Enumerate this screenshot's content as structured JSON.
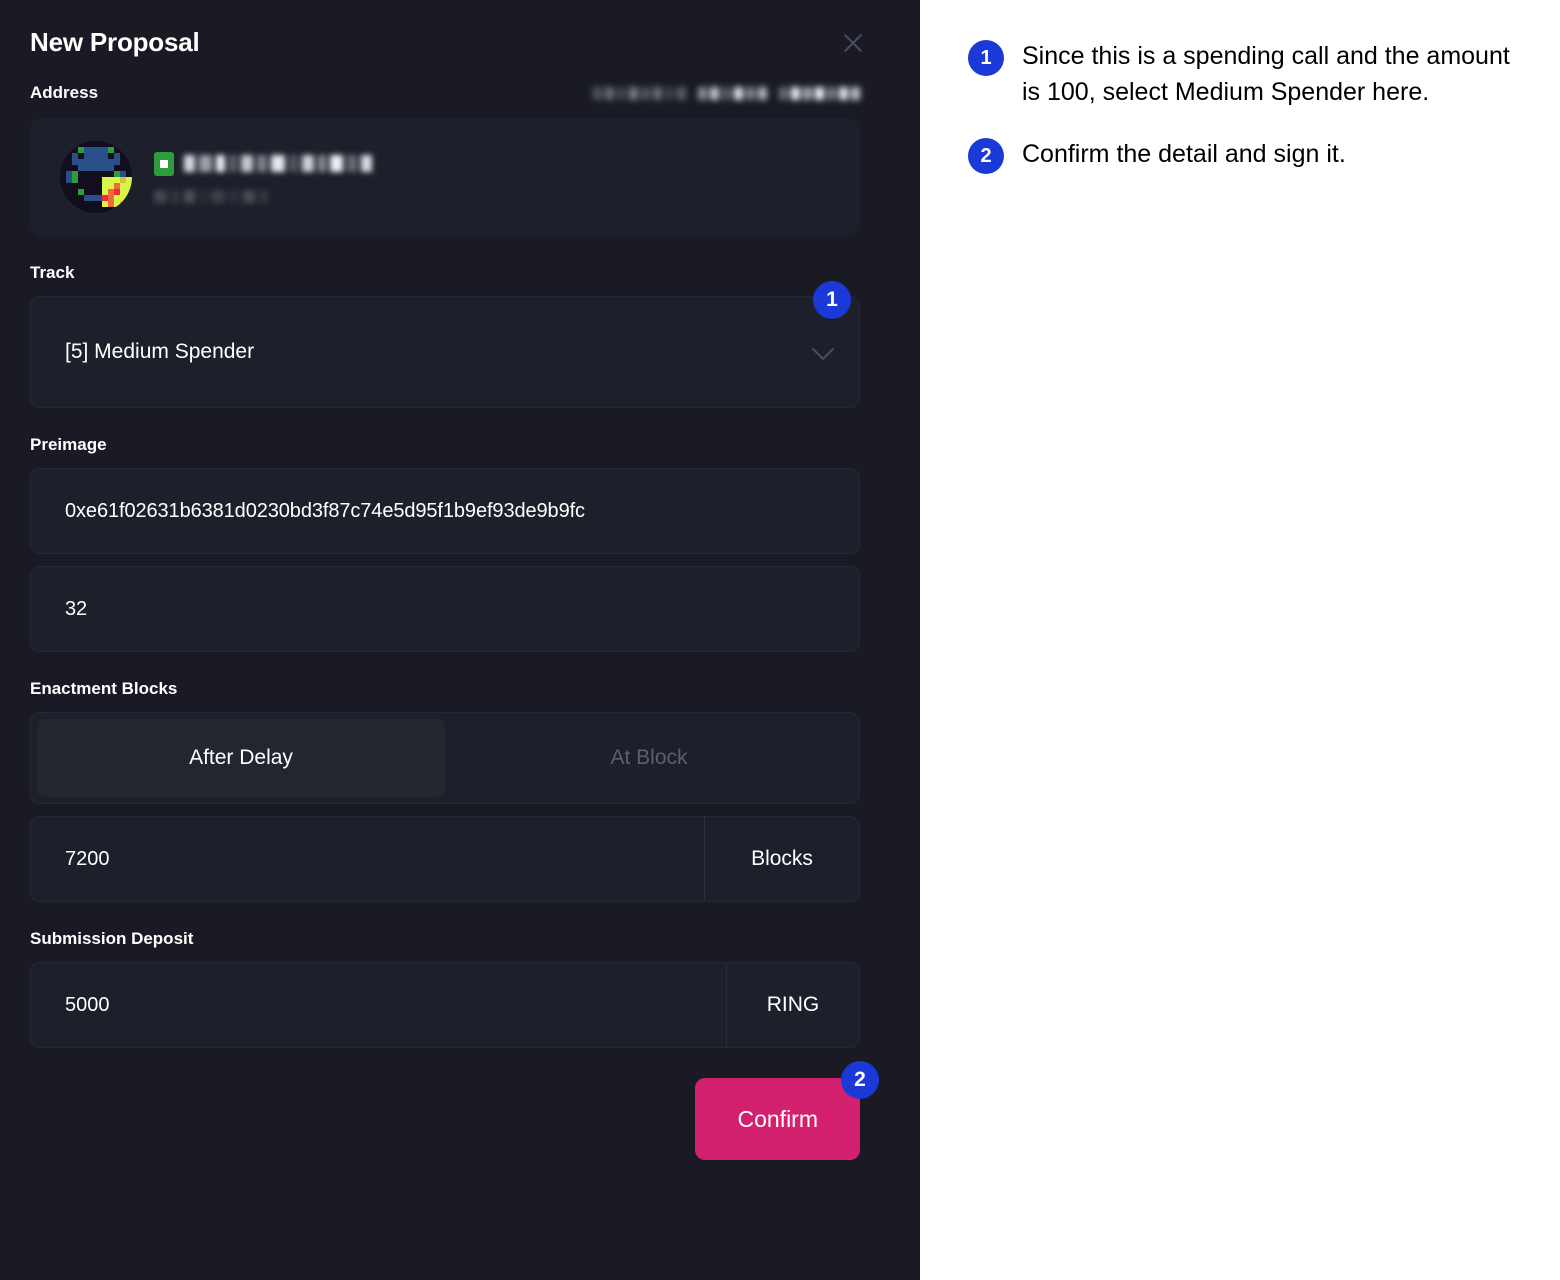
{
  "modal": {
    "title": "New Proposal",
    "close_icon": "close-icon",
    "address": {
      "label": "Address",
      "redacted_value": "[redacted]",
      "account_name_redacted": "[redacted]",
      "account_sub_redacted": "[redacted]",
      "identicon": "identicon-avatar",
      "chain_chip": "chain-chip-icon"
    },
    "track": {
      "label": "Track",
      "value": "[5] Medium Spender",
      "chevron_icon": "chevron-down-icon"
    },
    "preimage": {
      "label": "Preimage",
      "hash": "0xe61f02631b6381d0230bd3f87c74e5d95f1b9ef93de9b9fc",
      "length": "32"
    },
    "enactment": {
      "label": "Enactment Blocks",
      "option_after_delay": "After Delay",
      "option_at_block": "At Block",
      "selected": "After Delay",
      "value": "7200",
      "unit": "Blocks"
    },
    "deposit": {
      "label": "Submission Deposit",
      "value": "5000",
      "unit": "RING"
    },
    "confirm_label": "Confirm",
    "badges": {
      "one": "1",
      "two": "2"
    }
  },
  "notes": [
    {
      "num": "1",
      "text": "Since this is a spending call and the amount is 100, select Medium Spender here."
    },
    {
      "num": "2",
      "text": "Confirm the detail and sign it."
    }
  ],
  "colors": {
    "panel_bg": "#191a24",
    "field_bg": "#1d1f2b",
    "border": "#262935",
    "badge_blue": "#1a39d6",
    "confirm_pink": "#d4216f",
    "text_primary": "#ffffff",
    "text_muted": "#5c5f6e"
  }
}
